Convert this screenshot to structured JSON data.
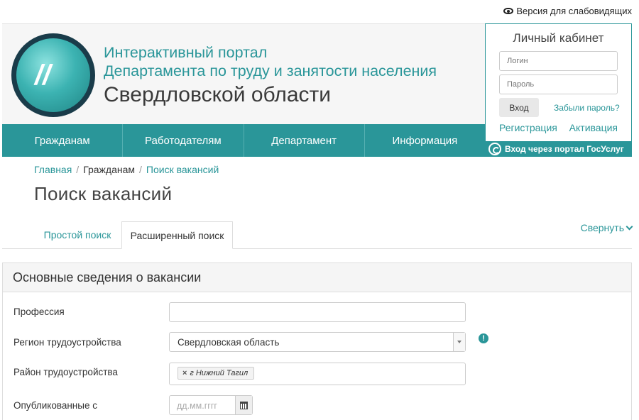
{
  "top_link": {
    "label": "Версия для слабовидящих",
    "icon": "eye-icon"
  },
  "header": {
    "title_line1": "Интерактивный портал",
    "title_line2": "Департамента по труду и занятости населения",
    "title_line3": "Свердловской области",
    "accent_color": "#2a9699"
  },
  "nav": {
    "items": [
      {
        "label": "Гражданам"
      },
      {
        "label": "Работодателям"
      },
      {
        "label": "Департамент"
      },
      {
        "label": "Информация"
      }
    ]
  },
  "cabinet": {
    "title": "Личный кабинет",
    "login_placeholder": "Логин",
    "password_placeholder": "Пароль",
    "login_button": "Вход",
    "forgot_link": "Забыли пароль?",
    "register_link": "Регистрация",
    "activate_link": "Активация",
    "gosuslugi_button": "Вход через портал ГосУслуг"
  },
  "breadcrumb": {
    "home": "Главная",
    "separator": "/",
    "section": "Гражданам",
    "current": "Поиск вакансий"
  },
  "page_title": "Поиск вакансий",
  "tabs": {
    "simple": "Простой поиск",
    "advanced": "Расширенный поиск",
    "active": "advanced",
    "collapse": "Свернуть"
  },
  "form": {
    "section_title": "Основные сведения о вакансии",
    "profession_label": "Профессия",
    "profession_value": "",
    "region_label": "Регион трудоустройства",
    "region_value": "Свердловская область",
    "region_info_icon": "!",
    "district_label": "Район трудоустройства",
    "district_tag": "г Нижний Тагил",
    "district_tag_remove": "×",
    "published_label": "Опубликованные с",
    "published_placeholder": "дд.мм.гггг"
  }
}
